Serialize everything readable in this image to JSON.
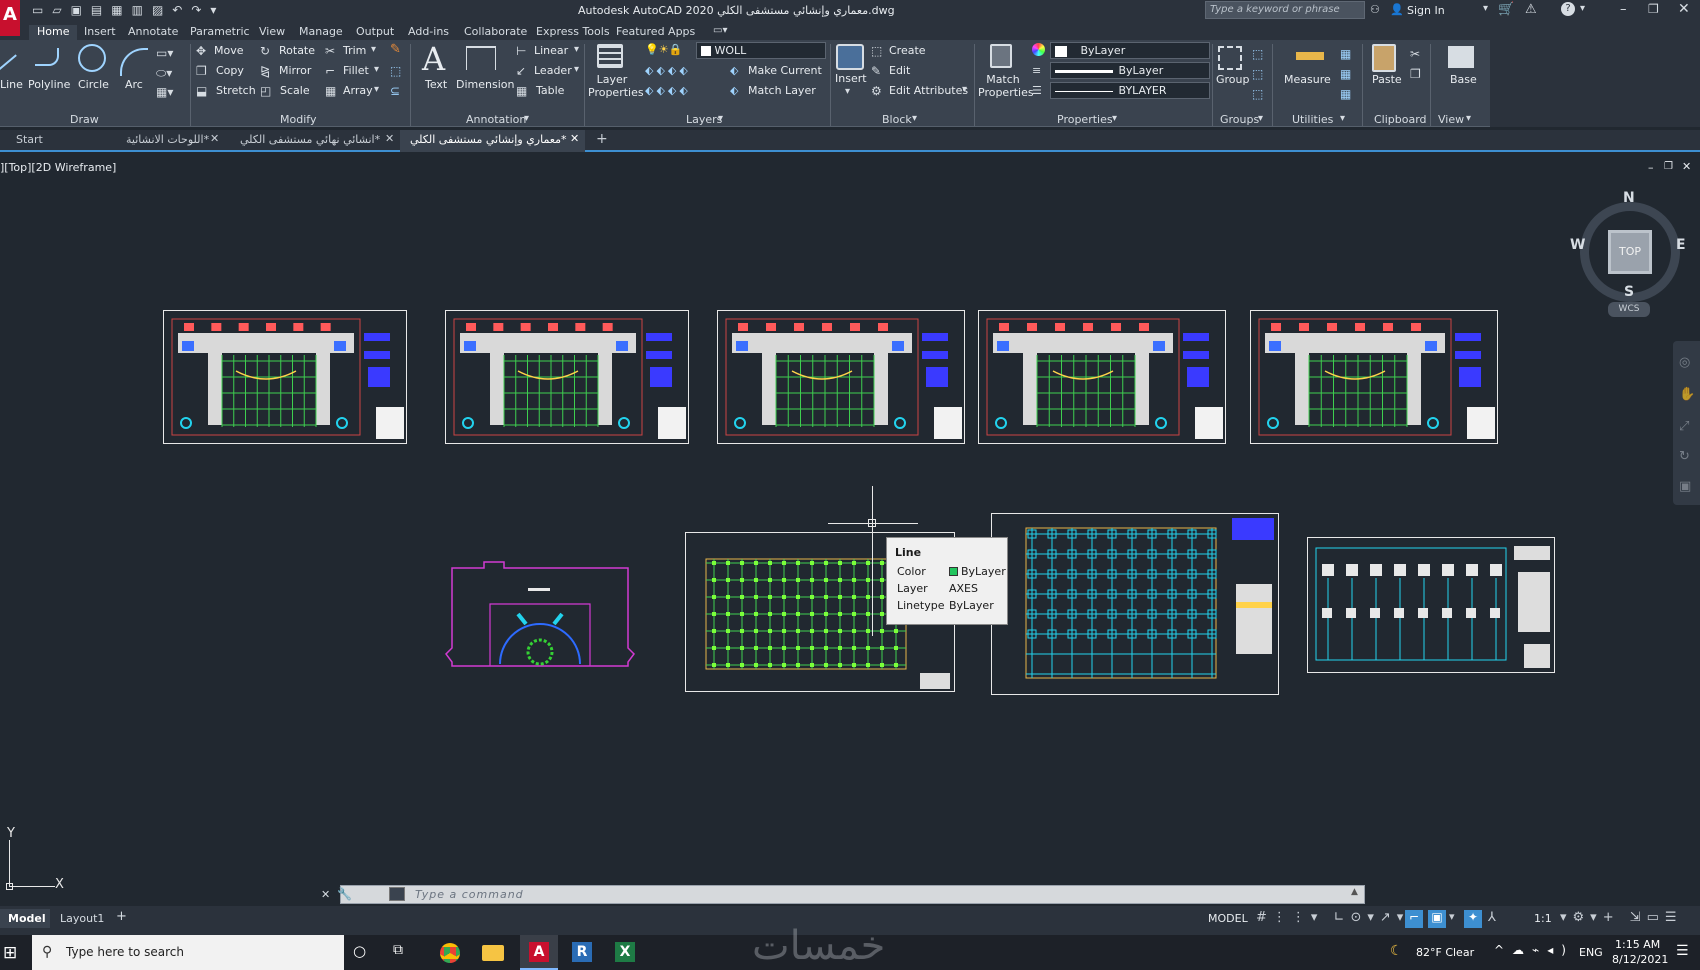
{
  "app": {
    "window_title": "Autodesk AutoCAD 2020  معماري وإنشائي مستشفى الكلي.dwg",
    "search_placeholder": "Type a keyword or phrase",
    "sign_in": "Sign In"
  },
  "ribbon_tabs": [
    "Home",
    "Insert",
    "Annotate",
    "Parametric",
    "View",
    "Manage",
    "Output",
    "Add-ins",
    "Collaborate",
    "Express Tools",
    "Featured Apps"
  ],
  "draw": {
    "line": "Line",
    "polyline": "Polyline",
    "circle": "Circle",
    "arc": "Arc",
    "panel": "Draw"
  },
  "modify": {
    "move": "Move",
    "rotate": "Rotate",
    "trim": "Trim",
    "copy": "Copy",
    "mirror": "Mirror",
    "fillet": "Fillet",
    "stretch": "Stretch",
    "scale": "Scale",
    "array": "Array",
    "panel": "Modify"
  },
  "annotation": {
    "text": "Text",
    "dimension": "Dimension",
    "linear": "Linear",
    "leader": "Leader",
    "table": "Table",
    "panel": "Annotation"
  },
  "layers": {
    "layer_properties": "Layer Properties",
    "current_layer": "WOLL",
    "make_current": "Make Current",
    "match_layer": "Match Layer",
    "panel": "Layers"
  },
  "block": {
    "insert": "Insert",
    "create": "Create",
    "edit": "Edit",
    "edit_attributes": "Edit Attributes",
    "panel": "Block"
  },
  "properties": {
    "match_properties": "Match Properties",
    "color": "ByLayer",
    "lineweight": "ByLayer",
    "linetype": "BYLAYER",
    "panel": "Properties"
  },
  "groups": {
    "group": "Group",
    "panel": "Groups"
  },
  "utilities": {
    "measure": "Measure",
    "panel": "Utilities"
  },
  "clipboard": {
    "paste": "Paste",
    "panel": "Clipboard"
  },
  "view": {
    "base": "Base",
    "panel": "View"
  },
  "doc_tabs": [
    "Start",
    "اللوحات الانشائية*",
    "انشائي نهائي مستشفى الكلي*",
    "معماري وإنشائي مستشفى الكلي*"
  ],
  "viewport_label": "][Top][2D Wireframe]",
  "viewcube": {
    "top": "TOP",
    "n": "N",
    "s": "S",
    "e": "E",
    "w": "W",
    "wcs": "WCS"
  },
  "tooltip": {
    "title": "Line",
    "rows": [
      {
        "k": "Color",
        "v": "ByLayer"
      },
      {
        "k": "Layer",
        "v": "AXES"
      },
      {
        "k": "Linetype",
        "v": "ByLayer"
      }
    ],
    "swatch": "#22c55e"
  },
  "ucs": {
    "x": "X",
    "y": "Y"
  },
  "command": {
    "placeholder": "Type a command"
  },
  "layout_tabs": [
    "Model",
    "Layout1"
  ],
  "status": {
    "model": "MODEL",
    "scale": "1:1"
  },
  "taskbar": {
    "search": "Type here to search",
    "weather": "82°F  Clear",
    "lang": "ENG",
    "time": "1:15 AM",
    "date": "8/12/2021"
  },
  "watermark": "خمسات",
  "colors": {
    "accent": "#3d8fd1",
    "app_red": "#c8102e",
    "viewport_bg": "#212830",
    "ribbon_bg": "#3a434f"
  }
}
